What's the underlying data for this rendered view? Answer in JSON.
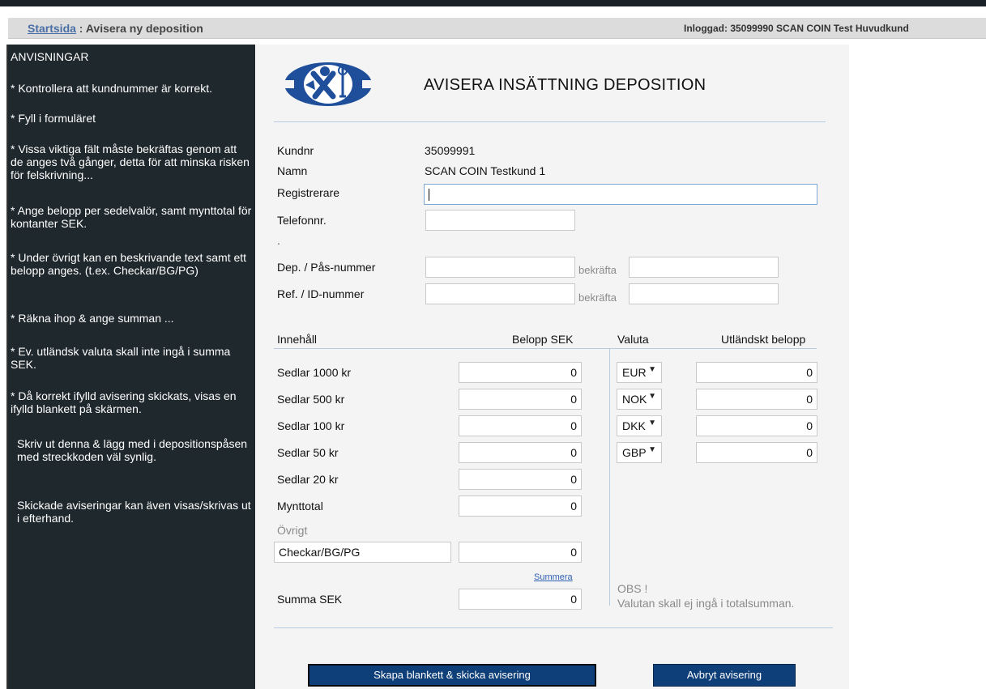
{
  "topbar": {
    "home_link": "Startsida",
    "separator": " : ",
    "page_title": "Avisera ny deposition",
    "logged_in": "Inloggad: 35099990 SCAN COIN Test Huvudkund"
  },
  "sidebar": {
    "title": "ANVISNINGAR",
    "items": [
      "* Kontrollera att kundnummer är korrekt.",
      "* Fyll i formuläret",
      "* Vissa viktiga fält måste bekräftas genom att de anges två gånger, detta  för att minska risken för felskrivning...",
      "* Ange belopp per sedelvalör, samt mynttotal för kontanter SEK.",
      "* Under övrigt kan en beskrivande  text samt ett belopp anges. (t.ex. Checkar/BG/PG)",
      "* Räkna ihop & ange summan ...",
      "* Ev. utländsk valuta skall inte ingå i summa SEK.",
      "* Då korrekt ifylld avisering skickats, visas en ifylld blankett på skärmen.",
      "Skriv ut denna & lägg med i depositionspåsen med streckkoden väl synlig.",
      "Skickade aviseringar kan även visas/skrivas ut i efterhand."
    ]
  },
  "form": {
    "title": "AVISERA INSÄTTNING DEPOSITION",
    "kundnr_label": "Kundnr",
    "kundnr_value": "35099991",
    "namn_label": "Namn",
    "namn_value": "SCAN COIN Testkund 1",
    "registrerare_label": "Registrerare",
    "registrerare_value": "",
    "telefon_label": "Telefonnr.",
    "telefon_value": "",
    "dot": ".",
    "dep_label": "Dep. / Pås-nummer",
    "ref_label": "Ref. / ID-nummer",
    "confirm_label": "bekräfta",
    "dep_value": "",
    "dep_confirm_value": "",
    "ref_value": "",
    "ref_confirm_value": ""
  },
  "content_table": {
    "header_innehall": "Innehåll",
    "header_belopp": "Belopp SEK",
    "header_valuta": "Valuta",
    "header_utl": "Utländskt belopp",
    "rows": [
      {
        "label": "Sedlar 1000 kr",
        "value": "0"
      },
      {
        "label": "Sedlar 500 kr",
        "value": "0"
      },
      {
        "label": "Sedlar 100 kr",
        "value": "0"
      },
      {
        "label": "Sedlar 50 kr",
        "value": "0"
      },
      {
        "label": "Sedlar 20 kr",
        "value": "0"
      },
      {
        "label": "Mynttotal",
        "value": "0"
      }
    ],
    "ovrigt_label": "Övrigt",
    "ovrigt_text": "Checkar/BG/PG",
    "ovrigt_value": "0",
    "summera_link": "Summera",
    "summa_label": "Summa SEK",
    "summa_value": "0",
    "currencies": [
      {
        "code": "EUR",
        "amount": "0"
      },
      {
        "code": "NOK",
        "amount": "0"
      },
      {
        "code": "DKK",
        "amount": "0"
      },
      {
        "code": "GBP",
        "amount": "0"
      }
    ],
    "obs_title": "OBS !",
    "obs_text": "Valutan skall ej ingå i totalsumman."
  },
  "buttons": {
    "submit": "Skapa blankett & skicka avisering",
    "cancel": "Avbryt avisering"
  },
  "colors": {
    "sidebar_bg": "#1f282d",
    "button_bg": "#0f3f78",
    "logo_blue": "#1f4f9a",
    "link": "#4a6fa5"
  }
}
